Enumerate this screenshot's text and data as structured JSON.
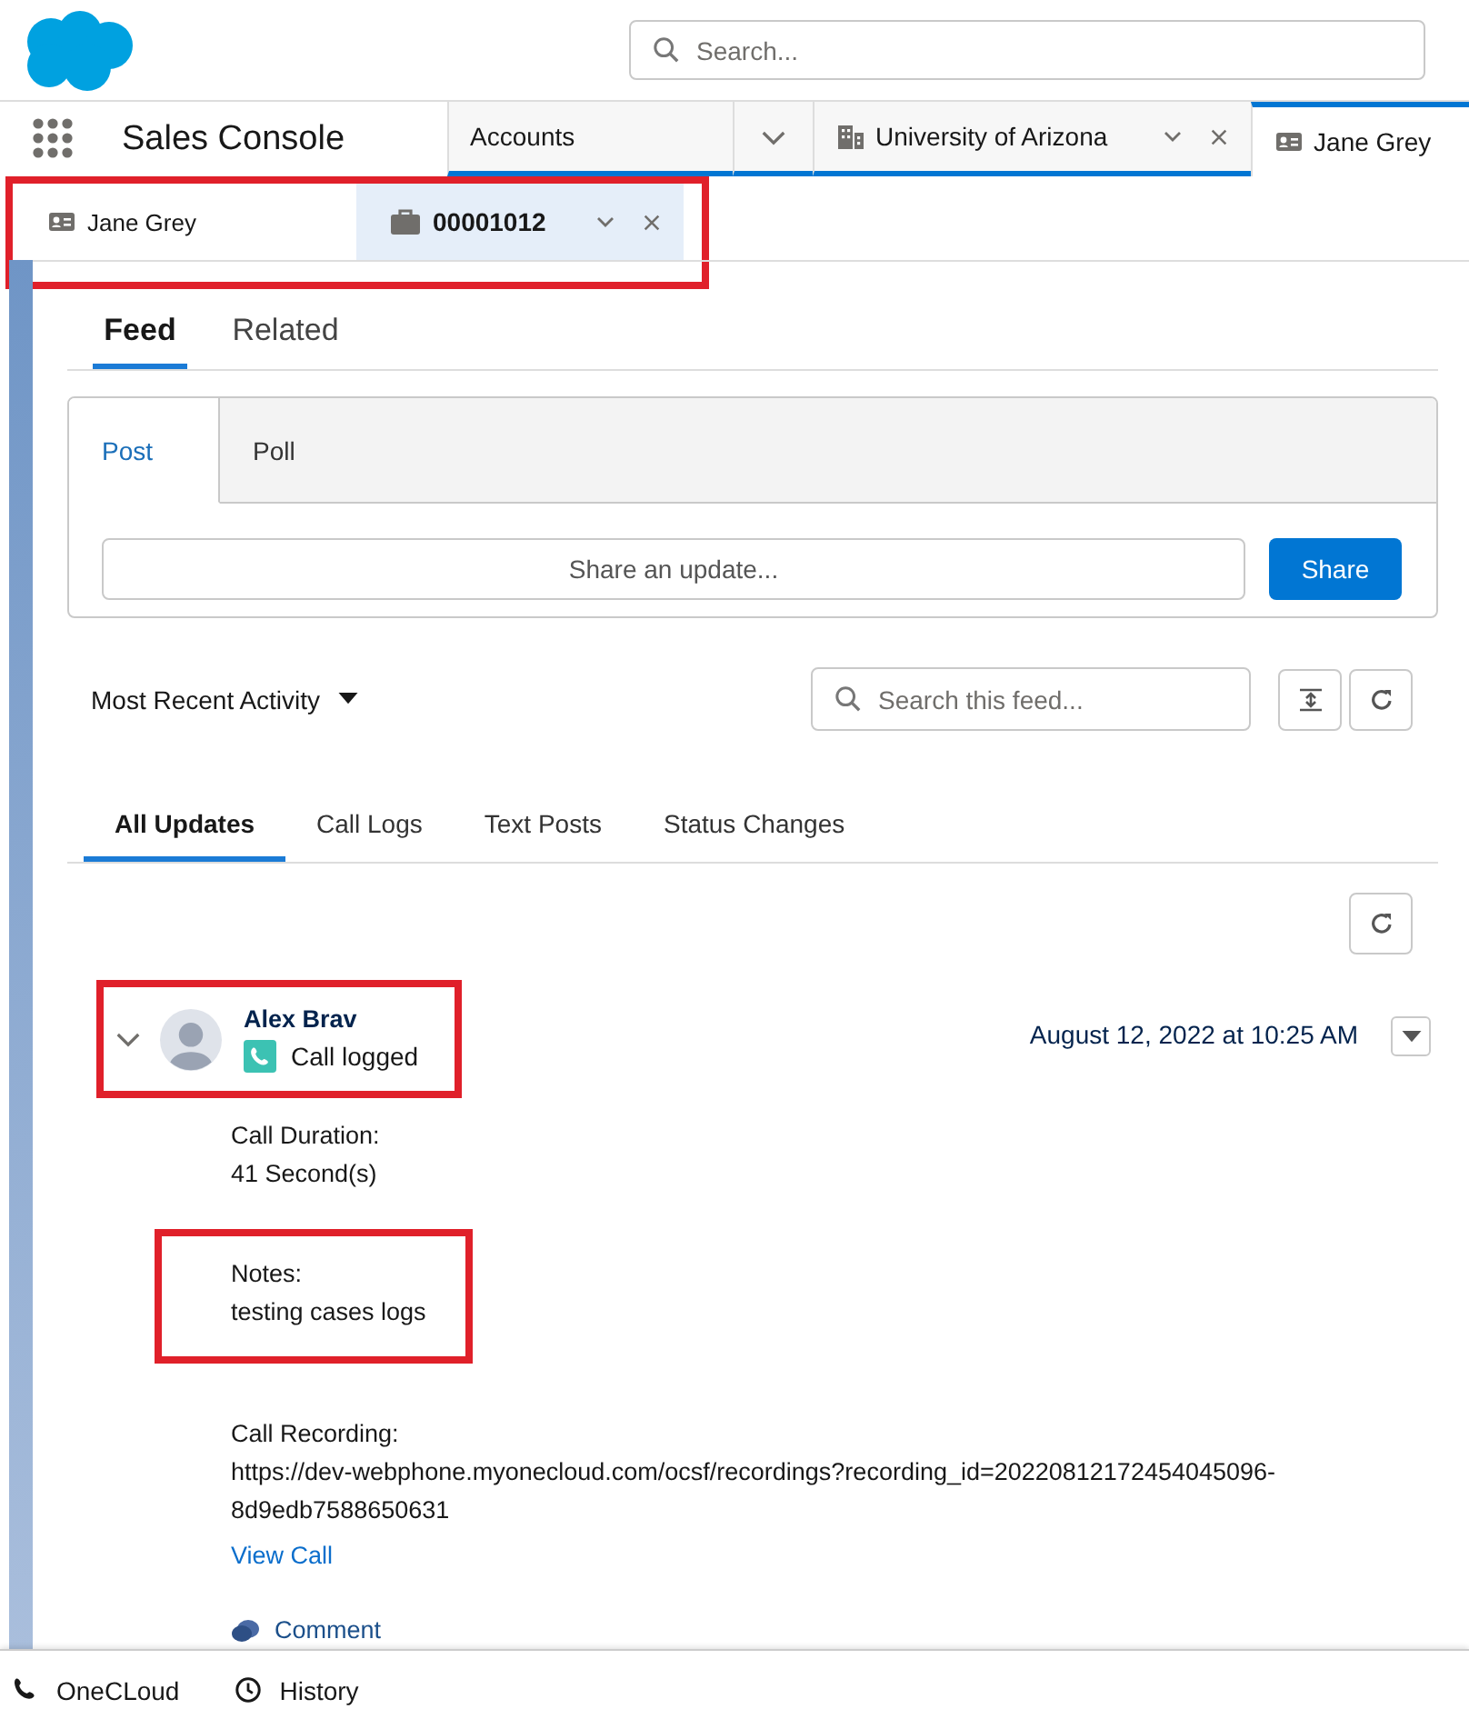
{
  "header": {
    "search_placeholder": "Search..."
  },
  "nav": {
    "app_name": "Sales Console",
    "tabs": [
      {
        "label": "Accounts",
        "kind": "nav_menu",
        "selected": false,
        "closable": false
      },
      {
        "label": "University of Arizona",
        "kind": "account",
        "selected": false,
        "closable": true
      },
      {
        "label": "Jane Grey",
        "kind": "contact",
        "selected": true,
        "closable": false
      }
    ]
  },
  "subtabs": {
    "highlighted": true,
    "items": [
      {
        "label": "Jane Grey",
        "kind": "contact",
        "selected": false,
        "closable": false
      },
      {
        "label": "00001012",
        "kind": "case",
        "selected": true,
        "closable": true
      }
    ]
  },
  "record_tabs": [
    {
      "label": "Feed",
      "selected": true
    },
    {
      "label": "Related",
      "selected": false
    }
  ],
  "publisher": {
    "tabs": [
      {
        "label": "Post",
        "selected": true
      },
      {
        "label": "Poll",
        "selected": false
      }
    ],
    "placeholder": "Share an update...",
    "button": "Share"
  },
  "feed_controls": {
    "sort": "Most Recent Activity",
    "search_placeholder": "Search this feed..."
  },
  "filters": [
    {
      "label": "All Updates",
      "selected": true
    },
    {
      "label": "Call Logs",
      "selected": false
    },
    {
      "label": "Text Posts",
      "selected": false
    },
    {
      "label": "Status Changes",
      "selected": false
    }
  ],
  "feed_item": {
    "author": "Alex Brav",
    "action": "Call logged",
    "timestamp": "August 12, 2022 at 10:25 AM",
    "highlighted": true,
    "fields": [
      {
        "label": "Call Duration:",
        "value": "41 Second(s)",
        "highlighted": false
      },
      {
        "label": "Notes:",
        "value": "testing cases logs",
        "highlighted": true
      },
      {
        "label": "Call Recording:",
        "value": "https://dev-webphone.myonecloud.com/ocsf/recordings?recording_id=20220812172454045096-8d9edb7588650631",
        "highlighted": false
      }
    ],
    "link": "View Call",
    "comment": "Comment"
  },
  "utility_bar": [
    {
      "label": "OneCLoud",
      "kind": "phone"
    },
    {
      "label": "History",
      "kind": "history"
    }
  ]
}
